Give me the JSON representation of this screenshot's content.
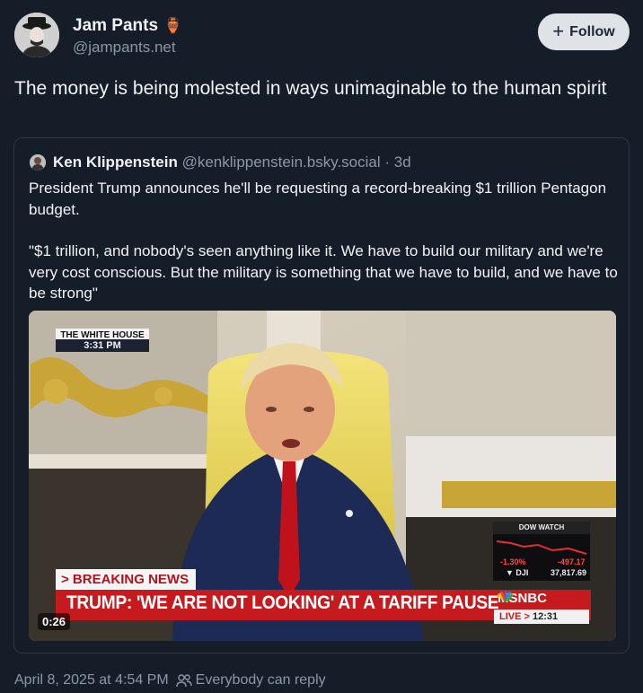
{
  "author": {
    "name": "Jam Pants",
    "emoji": "🏺",
    "handle": "@jampants.net"
  },
  "follow_button": {
    "plus": "+",
    "label": "Follow"
  },
  "post": {
    "text": "The money is being molested in ways unimaginable to the human spirit"
  },
  "quote": {
    "name": "Ken Klippenstein",
    "handle": "@kenklippenstein.bsky.social",
    "separator": "·",
    "age": "3d",
    "paragraph_1": "President Trump announces he'll be requesting a record-breaking $1 trillion Pentagon budget.",
    "paragraph_2": "\"$1 trillion, and nobody's seen anything like it. We have to build our military and we're very cost conscious. But the military is something that we have to build, and we have to be strong\""
  },
  "video": {
    "location_label": "THE WHITE HOUSE",
    "location_time": "3:31 PM",
    "dow": {
      "title": "DOW WATCH",
      "percent": "-1.30%",
      "change": "-497.17",
      "symbol": "▼ DJI",
      "value": "37,817.69"
    },
    "breaking_label": "> BREAKING NEWS",
    "headline": "TRUMP: 'WE ARE NOT LOOKING' AT A TARIFF PAUSE",
    "network": "MSNBC",
    "live_label": "LIVE",
    "live_arrow": ">",
    "live_time": "12:31",
    "timecode": "0:26"
  },
  "footer": {
    "timestamp": "April 8, 2025 at 4:54 PM",
    "reply_setting": "Everybody can reply"
  },
  "colors": {
    "background": "#151d28",
    "muted_text": "#8b98a8",
    "follow_bg": "#dfe3e8",
    "news_red": "#c51a1e"
  }
}
